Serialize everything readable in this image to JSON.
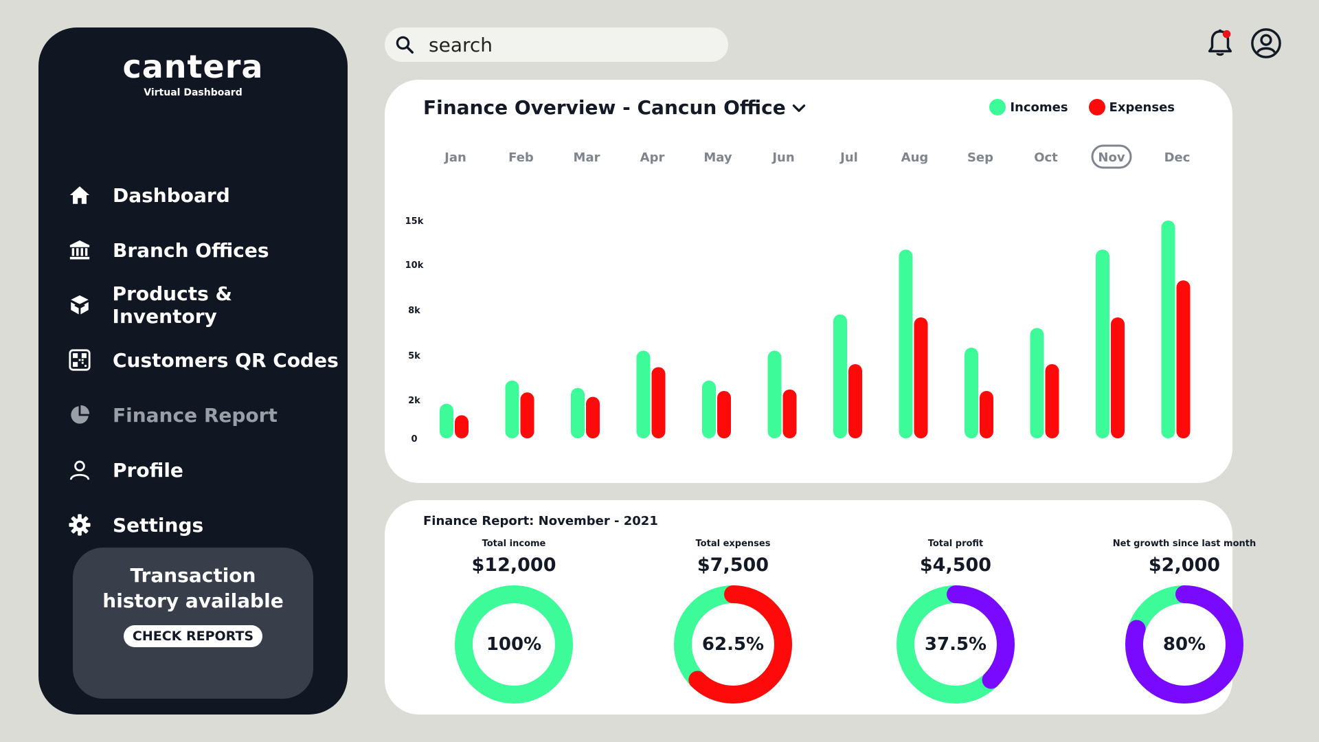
{
  "brand": {
    "name": "cantera",
    "subtitle": "Virtual Dashboard"
  },
  "nav": {
    "items": [
      {
        "label": "Dashboard",
        "icon": "home-icon",
        "active": false
      },
      {
        "label": "Branch Offices",
        "icon": "bank-icon",
        "active": false
      },
      {
        "label": "Products & Inventory",
        "icon": "box-icon",
        "active": false
      },
      {
        "label": "Customers QR Codes",
        "icon": "qr-code-icon",
        "active": false
      },
      {
        "label": "Finance Report",
        "icon": "pie-chart-icon",
        "active": true
      },
      {
        "label": "Profile",
        "icon": "user-icon",
        "active": false
      },
      {
        "label": "Settings",
        "icon": "gear-icon",
        "active": false
      }
    ]
  },
  "promo": {
    "title": "Transaction\nhistory available",
    "button": "CHECK REPORTS"
  },
  "search": {
    "placeholder": "search"
  },
  "colors": {
    "income": "#3dfb98",
    "expense": "#ff0a0a",
    "profit": "#7a0aff",
    "sidebar": "#111722",
    "background": "#dcdcd7",
    "notification_dot": "#e8131b"
  },
  "overview": {
    "title": "Finance Overview - Cancun Office",
    "legend": [
      "Incomes",
      "Expenses"
    ],
    "highlight_month": "Nov"
  },
  "chart_data": {
    "type": "bar",
    "title": "Finance Overview - Cancun Office",
    "categories": [
      "Jan",
      "Feb",
      "Mar",
      "Apr",
      "May",
      "Jun",
      "Jul",
      "Aug",
      "Sep",
      "Oct",
      "Nov",
      "Dec"
    ],
    "y_ticks": [
      "0",
      "2k",
      "5k",
      "8k",
      "10k",
      "15k"
    ],
    "series": [
      {
        "name": "Incomes",
        "values": [
          1.8,
          3.3,
          2.8,
          5.3,
          3.3,
          5.3,
          7.7,
          11.7,
          5.5,
          6.8,
          11.7,
          15.0
        ]
      },
      {
        "name": "Expenses",
        "values": [
          1.2,
          2.5,
          2.2,
          4.2,
          2.6,
          2.7,
          4.4,
          7.5,
          2.6,
          4.4,
          7.5,
          9.3
        ]
      }
    ],
    "ylim": [
      0,
      15
    ],
    "legend": "top-right",
    "grid": false
  },
  "report": {
    "title": "Finance Report: November - 2021",
    "metrics": [
      {
        "label": "Total income",
        "value": "$12,000",
        "percent": "100%",
        "fraction": 1.0,
        "arc_color": "#3dfb98",
        "track_color": "#3dfb98"
      },
      {
        "label": "Total expenses",
        "value": "$7,500",
        "percent": "62.5%",
        "fraction": 0.625,
        "arc_color": "#ff0a0a",
        "track_color": "#3dfb98"
      },
      {
        "label": "Total profit",
        "value": "$4,500",
        "percent": "37.5%",
        "fraction": 0.375,
        "arc_color": "#7a0aff",
        "track_color": "#3dfb98"
      },
      {
        "label": "Net growth since last month",
        "value": "$2,000",
        "percent": "80%",
        "fraction": 0.8,
        "arc_color": "#7a0aff",
        "track_color": "#3dfb98"
      }
    ]
  }
}
